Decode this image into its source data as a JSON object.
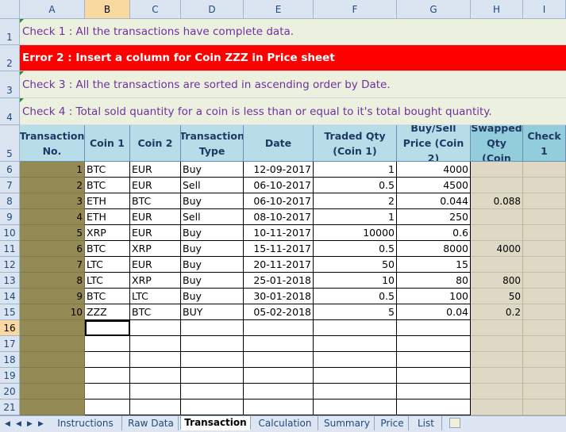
{
  "columns": [
    "A",
    "B",
    "C",
    "D",
    "E",
    "F",
    "G",
    "H",
    "I"
  ],
  "selected_column": "B",
  "selected_row": "16",
  "rows": [
    "1",
    "2",
    "3",
    "4",
    "5",
    "6",
    "7",
    "8",
    "9",
    "10",
    "11",
    "12",
    "13",
    "14",
    "15",
    "16",
    "17",
    "18",
    "19",
    "20",
    "21"
  ],
  "checks": {
    "c1": "Check 1 : All the transactions have complete data.",
    "c2": "Error 2 : Insert a column for Coin ZZZ in Price sheet",
    "c3": "Check 3 : All the transactions are sorted in ascending order by Date.",
    "c4": "Check 4 : Total sold quantity for a coin is less than or equal to it's total bought quantity."
  },
  "headers": {
    "a": "Transaction No.",
    "b": "Coin 1",
    "c": "Coin 2",
    "d": "Transaction Type",
    "e": "Date",
    "f": "Traded Qty (Coin 1)",
    "g": "Buy/Sell Price (Coin 2)",
    "h": "Swapped Qty (Coin",
    "i": "Check 1"
  },
  "data": [
    {
      "no": "1",
      "c1": "BTC",
      "c2": "EUR",
      "type": "Buy",
      "date": "12-09-2017",
      "qty": "1",
      "price": "4000",
      "swap": ""
    },
    {
      "no": "2",
      "c1": "BTC",
      "c2": "EUR",
      "type": "Sell",
      "date": "06-10-2017",
      "qty": "0.5",
      "price": "4500",
      "swap": ""
    },
    {
      "no": "3",
      "c1": "ETH",
      "c2": "BTC",
      "type": "Buy",
      "date": "06-10-2017",
      "qty": "2",
      "price": "0.044",
      "swap": "0.088"
    },
    {
      "no": "4",
      "c1": "ETH",
      "c2": "EUR",
      "type": "Sell",
      "date": "08-10-2017",
      "qty": "1",
      "price": "250",
      "swap": ""
    },
    {
      "no": "5",
      "c1": "XRP",
      "c2": "EUR",
      "type": "Buy",
      "date": "10-11-2017",
      "qty": "10000",
      "price": "0.6",
      "swap": ""
    },
    {
      "no": "6",
      "c1": "BTC",
      "c2": "XRP",
      "type": "Buy",
      "date": "15-11-2017",
      "qty": "0.5",
      "price": "8000",
      "swap": "4000"
    },
    {
      "no": "7",
      "c1": "LTC",
      "c2": "EUR",
      "type": "Buy",
      "date": "20-11-2017",
      "qty": "50",
      "price": "15",
      "swap": ""
    },
    {
      "no": "8",
      "c1": "LTC",
      "c2": "XRP",
      "type": "Buy",
      "date": "25-01-2018",
      "qty": "10",
      "price": "80",
      "swap": "800"
    },
    {
      "no": "9",
      "c1": "BTC",
      "c2": "LTC",
      "type": "Buy",
      "date": "30-01-2018",
      "qty": "0.5",
      "price": "100",
      "swap": "50"
    },
    {
      "no": "10",
      "c1": "ZZZ",
      "c2": "BTC",
      "type": "BUY",
      "date": "05-02-2018",
      "qty": "5",
      "price": "0.04",
      "swap": "0.2"
    }
  ],
  "tabs": [
    "Instructions",
    "Raw Data",
    "Transaction",
    "Calculation",
    "Summary",
    "Price",
    "List"
  ],
  "active_tab": "Transaction",
  "colors": {
    "check_bg": "#ebf1de",
    "check_text": "#7030a0",
    "error_bg": "#ff0000",
    "header_bg": "#b7dee8",
    "olive": "#948a54",
    "tan": "#ddd9c4"
  }
}
